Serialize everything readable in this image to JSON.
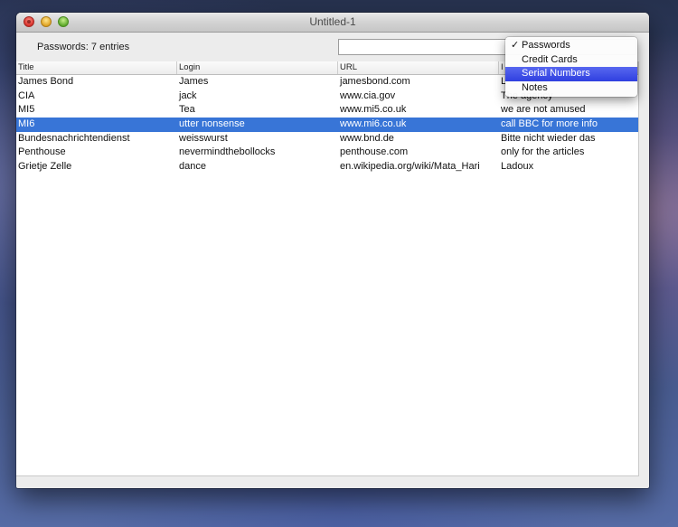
{
  "window": {
    "title": "Untitled-1"
  },
  "toolbar": {
    "count_label": "Passwords: 7 entries",
    "search_value": "",
    "search_placeholder": ""
  },
  "table": {
    "columns": [
      "Title",
      "Login",
      "URL",
      "I"
    ],
    "rows": [
      [
        "James Bond",
        "James",
        "jamesbond.com",
        "L"
      ],
      [
        "CIA",
        "jack",
        "www.cia.gov",
        "The agency"
      ],
      [
        "MI5",
        "Tea",
        "www.mi5.co.uk",
        "we are not amused"
      ],
      [
        "MI6",
        "utter nonsense",
        "www.mi6.co.uk",
        "call BBC for more info"
      ],
      [
        "Bundesnachrichtendienst",
        "weisswurst",
        "www.bnd.de",
        "Bitte nicht wieder das"
      ],
      [
        "Penthouse",
        "nevermindthebollocks",
        "penthouse.com",
        "only for the articles"
      ],
      [
        "Grietje Zelle",
        "dance",
        "en.wikipedia.org/wiki/Mata_Hari",
        "Ladoux"
      ]
    ],
    "selected_row_index": 3
  },
  "category_menu": {
    "items": [
      "Passwords",
      "Credit Cards",
      "Serial Numbers",
      "Notes"
    ],
    "checked": "Passwords",
    "highlighted": "Serial Numbers",
    "check_glyph": "✓"
  },
  "colors": {
    "selection": "#3875d7",
    "menu_highlight": "#3a4ae6"
  },
  "icons": {
    "close": "close-button-icon",
    "minimize": "minimize-button-icon",
    "zoom": "zoom-button-icon",
    "check": "checkmark-icon"
  }
}
